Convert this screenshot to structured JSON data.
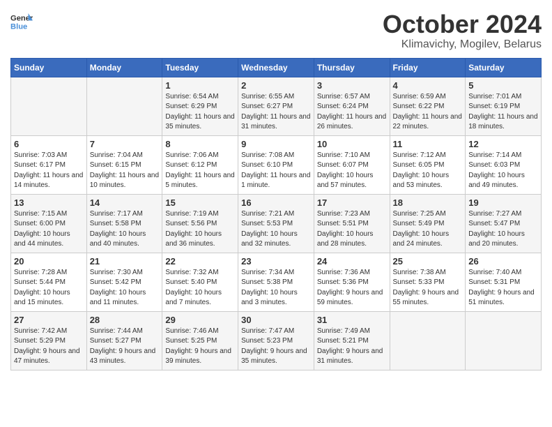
{
  "header": {
    "logo_line1": "General",
    "logo_line2": "Blue",
    "month": "October 2024",
    "location": "Klimavichy, Mogilev, Belarus"
  },
  "weekdays": [
    "Sunday",
    "Monday",
    "Tuesday",
    "Wednesday",
    "Thursday",
    "Friday",
    "Saturday"
  ],
  "rows": [
    [
      {
        "day": null
      },
      {
        "day": null
      },
      {
        "day": "1",
        "sunrise": "Sunrise: 6:54 AM",
        "sunset": "Sunset: 6:29 PM",
        "daylight": "Daylight: 11 hours and 35 minutes."
      },
      {
        "day": "2",
        "sunrise": "Sunrise: 6:55 AM",
        "sunset": "Sunset: 6:27 PM",
        "daylight": "Daylight: 11 hours and 31 minutes."
      },
      {
        "day": "3",
        "sunrise": "Sunrise: 6:57 AM",
        "sunset": "Sunset: 6:24 PM",
        "daylight": "Daylight: 11 hours and 26 minutes."
      },
      {
        "day": "4",
        "sunrise": "Sunrise: 6:59 AM",
        "sunset": "Sunset: 6:22 PM",
        "daylight": "Daylight: 11 hours and 22 minutes."
      },
      {
        "day": "5",
        "sunrise": "Sunrise: 7:01 AM",
        "sunset": "Sunset: 6:19 PM",
        "daylight": "Daylight: 11 hours and 18 minutes."
      }
    ],
    [
      {
        "day": "6",
        "sunrise": "Sunrise: 7:03 AM",
        "sunset": "Sunset: 6:17 PM",
        "daylight": "Daylight: 11 hours and 14 minutes."
      },
      {
        "day": "7",
        "sunrise": "Sunrise: 7:04 AM",
        "sunset": "Sunset: 6:15 PM",
        "daylight": "Daylight: 11 hours and 10 minutes."
      },
      {
        "day": "8",
        "sunrise": "Sunrise: 7:06 AM",
        "sunset": "Sunset: 6:12 PM",
        "daylight": "Daylight: 11 hours and 5 minutes."
      },
      {
        "day": "9",
        "sunrise": "Sunrise: 7:08 AM",
        "sunset": "Sunset: 6:10 PM",
        "daylight": "Daylight: 11 hours and 1 minute."
      },
      {
        "day": "10",
        "sunrise": "Sunrise: 7:10 AM",
        "sunset": "Sunset: 6:07 PM",
        "daylight": "Daylight: 10 hours and 57 minutes."
      },
      {
        "day": "11",
        "sunrise": "Sunrise: 7:12 AM",
        "sunset": "Sunset: 6:05 PM",
        "daylight": "Daylight: 10 hours and 53 minutes."
      },
      {
        "day": "12",
        "sunrise": "Sunrise: 7:14 AM",
        "sunset": "Sunset: 6:03 PM",
        "daylight": "Daylight: 10 hours and 49 minutes."
      }
    ],
    [
      {
        "day": "13",
        "sunrise": "Sunrise: 7:15 AM",
        "sunset": "Sunset: 6:00 PM",
        "daylight": "Daylight: 10 hours and 44 minutes."
      },
      {
        "day": "14",
        "sunrise": "Sunrise: 7:17 AM",
        "sunset": "Sunset: 5:58 PM",
        "daylight": "Daylight: 10 hours and 40 minutes."
      },
      {
        "day": "15",
        "sunrise": "Sunrise: 7:19 AM",
        "sunset": "Sunset: 5:56 PM",
        "daylight": "Daylight: 10 hours and 36 minutes."
      },
      {
        "day": "16",
        "sunrise": "Sunrise: 7:21 AM",
        "sunset": "Sunset: 5:53 PM",
        "daylight": "Daylight: 10 hours and 32 minutes."
      },
      {
        "day": "17",
        "sunrise": "Sunrise: 7:23 AM",
        "sunset": "Sunset: 5:51 PM",
        "daylight": "Daylight: 10 hours and 28 minutes."
      },
      {
        "day": "18",
        "sunrise": "Sunrise: 7:25 AM",
        "sunset": "Sunset: 5:49 PM",
        "daylight": "Daylight: 10 hours and 24 minutes."
      },
      {
        "day": "19",
        "sunrise": "Sunrise: 7:27 AM",
        "sunset": "Sunset: 5:47 PM",
        "daylight": "Daylight: 10 hours and 20 minutes."
      }
    ],
    [
      {
        "day": "20",
        "sunrise": "Sunrise: 7:28 AM",
        "sunset": "Sunset: 5:44 PM",
        "daylight": "Daylight: 10 hours and 15 minutes."
      },
      {
        "day": "21",
        "sunrise": "Sunrise: 7:30 AM",
        "sunset": "Sunset: 5:42 PM",
        "daylight": "Daylight: 10 hours and 11 minutes."
      },
      {
        "day": "22",
        "sunrise": "Sunrise: 7:32 AM",
        "sunset": "Sunset: 5:40 PM",
        "daylight": "Daylight: 10 hours and 7 minutes."
      },
      {
        "day": "23",
        "sunrise": "Sunrise: 7:34 AM",
        "sunset": "Sunset: 5:38 PM",
        "daylight": "Daylight: 10 hours and 3 minutes."
      },
      {
        "day": "24",
        "sunrise": "Sunrise: 7:36 AM",
        "sunset": "Sunset: 5:36 PM",
        "daylight": "Daylight: 9 hours and 59 minutes."
      },
      {
        "day": "25",
        "sunrise": "Sunrise: 7:38 AM",
        "sunset": "Sunset: 5:33 PM",
        "daylight": "Daylight: 9 hours and 55 minutes."
      },
      {
        "day": "26",
        "sunrise": "Sunrise: 7:40 AM",
        "sunset": "Sunset: 5:31 PM",
        "daylight": "Daylight: 9 hours and 51 minutes."
      }
    ],
    [
      {
        "day": "27",
        "sunrise": "Sunrise: 7:42 AM",
        "sunset": "Sunset: 5:29 PM",
        "daylight": "Daylight: 9 hours and 47 minutes."
      },
      {
        "day": "28",
        "sunrise": "Sunrise: 7:44 AM",
        "sunset": "Sunset: 5:27 PM",
        "daylight": "Daylight: 9 hours and 43 minutes."
      },
      {
        "day": "29",
        "sunrise": "Sunrise: 7:46 AM",
        "sunset": "Sunset: 5:25 PM",
        "daylight": "Daylight: 9 hours and 39 minutes."
      },
      {
        "day": "30",
        "sunrise": "Sunrise: 7:47 AM",
        "sunset": "Sunset: 5:23 PM",
        "daylight": "Daylight: 9 hours and 35 minutes."
      },
      {
        "day": "31",
        "sunrise": "Sunrise: 7:49 AM",
        "sunset": "Sunset: 5:21 PM",
        "daylight": "Daylight: 9 hours and 31 minutes."
      },
      {
        "day": null
      },
      {
        "day": null
      }
    ]
  ]
}
